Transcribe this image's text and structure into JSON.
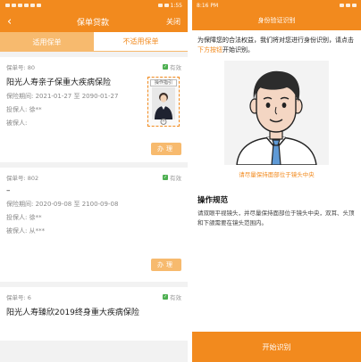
{
  "left": {
    "status": {
      "time": "1:55"
    },
    "nav": {
      "back": "‹",
      "title": "保单贷款",
      "close": "关闭"
    },
    "tabs": [
      {
        "label": "适用保单"
      },
      {
        "label": "不适用保单"
      }
    ],
    "cards": [
      {
        "policy_no": "保单号: 80",
        "status": "有效",
        "title": "阳光人寿亲子保重大疾病保险",
        "period": "保险期间: 2021-01-27 至 2090-01-27",
        "insured_holder": "投保人: 徐**",
        "insured": "被保人:",
        "action": "办理",
        "thumb_label": "操作指引"
      },
      {
        "policy_no": "保单号: 802",
        "status": "有效",
        "title": "–",
        "period": "保险期间: 2020-09-08 至 2100-09-08",
        "insured_holder": "投保人: 徐**",
        "insured": "被保人: 从***",
        "action": "办理"
      },
      {
        "policy_no": "保单号: 6",
        "status": "有效",
        "title": "阳光人寿臻欣2019终身重大疾病保险"
      }
    ]
  },
  "right": {
    "status": {
      "time": "8:16 PM"
    },
    "nav": {
      "title": "身份验证识别"
    },
    "intro": "为保障您的合法权益，我们将对您进行身份识别，请点击",
    "intro_link": "下方按钮",
    "intro_tail": "开始识别。",
    "hint": "请尽量保持面部位于镜头中央",
    "spec_title": "操作规范",
    "spec_text": "请双眼平视镜头，并尽量保持面部位于镜头中央，双耳、头顶和下颌需要在镜头范围内。",
    "start_button": "开始识别"
  },
  "colors": {
    "brand_orange": "#f28a1e",
    "light_orange": "#f7ba6e",
    "valid_green": "#4caf50"
  }
}
